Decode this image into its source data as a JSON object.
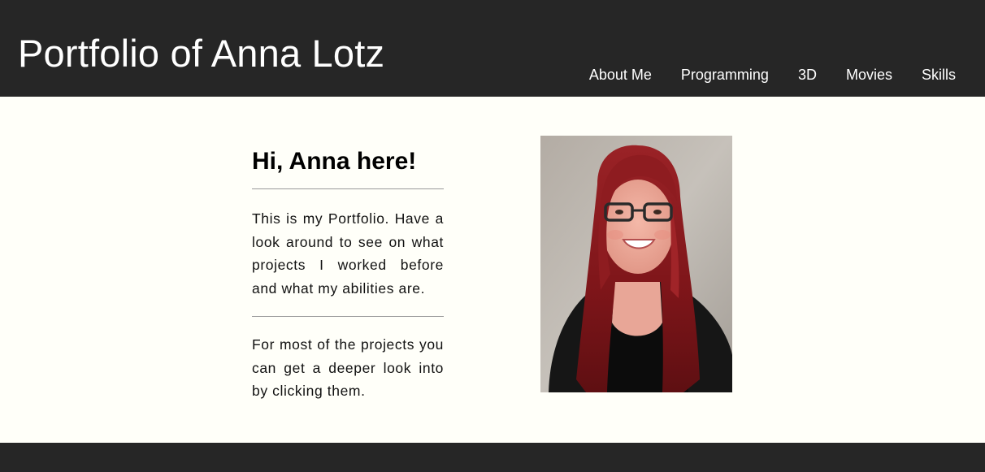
{
  "header": {
    "title": "Portfolio of Anna Lotz",
    "nav": [
      {
        "label": "About Me"
      },
      {
        "label": "Programming"
      },
      {
        "label": "3D"
      },
      {
        "label": "Movies"
      },
      {
        "label": "Skills"
      }
    ]
  },
  "intro": {
    "heading": "Hi, Anna here!",
    "paragraph_1": "This is my Portfolio. Have a look around to see on what projects I worked before and what my abilities are.",
    "paragraph_2": "For most of the projects you can get a deeper look into by clicking them."
  },
  "colors": {
    "header_background": "#262626",
    "page_background": "#fffff9",
    "hair": "#8a1a1e"
  }
}
